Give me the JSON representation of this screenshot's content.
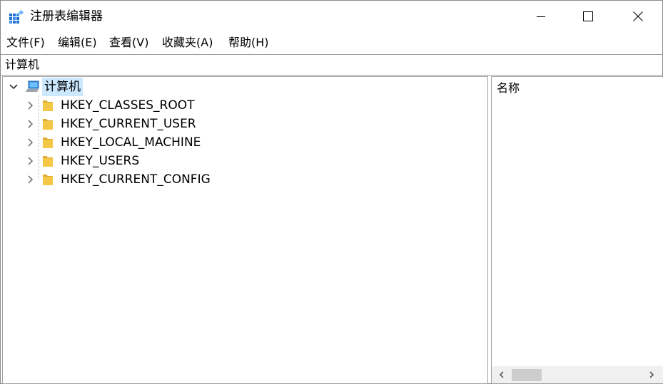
{
  "window": {
    "title": "注册表编辑器",
    "controls": {
      "minimize": "minimize",
      "maximize": "maximize",
      "close": "close"
    }
  },
  "menu": {
    "items": [
      {
        "label": "文件(F)"
      },
      {
        "label": "编辑(E)"
      },
      {
        "label": "查看(V)"
      },
      {
        "label": "收藏夹(A)"
      },
      {
        "label": "帮助(H)"
      }
    ]
  },
  "address": {
    "path": "计算机"
  },
  "tree": {
    "root": {
      "label": "计算机",
      "icon": "computer-icon",
      "expanded": true
    },
    "children": [
      {
        "label": "HKEY_CLASSES_ROOT",
        "icon": "folder-icon"
      },
      {
        "label": "HKEY_CURRENT_USER",
        "icon": "folder-icon"
      },
      {
        "label": "HKEY_LOCAL_MACHINE",
        "icon": "folder-icon"
      },
      {
        "label": "HKEY_USERS",
        "icon": "folder-icon"
      },
      {
        "label": "HKEY_CURRENT_CONFIG",
        "icon": "folder-icon"
      }
    ]
  },
  "list": {
    "columns": [
      {
        "label": "名称"
      }
    ]
  },
  "colors": {
    "selection": "#cce8ff",
    "folder": "#f5c746",
    "accent": "#0078d7"
  }
}
